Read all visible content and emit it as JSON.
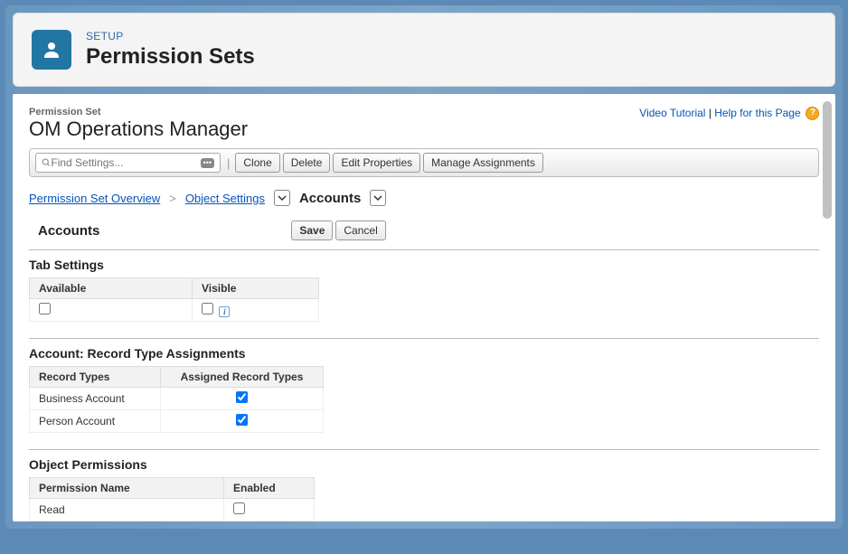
{
  "header": {
    "eyebrow": "SETUP",
    "title": "Permission Sets"
  },
  "page": {
    "subtitle": "Permission Set",
    "name": "OM Operations Manager",
    "links": {
      "video": "Video Tutorial",
      "help": "Help for this Page"
    }
  },
  "toolbar": {
    "search_placeholder": "Find Settings...",
    "buttons": {
      "clone": "Clone",
      "delete": "Delete",
      "edit": "Edit Properties",
      "assign": "Manage Assignments"
    }
  },
  "breadcrumb": {
    "overview": "Permission Set Overview",
    "object_settings": "Object Settings",
    "current": "Accounts"
  },
  "panel": {
    "title": "Accounts",
    "save": "Save",
    "cancel": "Cancel"
  },
  "sections": {
    "tab": {
      "title": "Tab Settings",
      "cols": {
        "available": "Available",
        "visible": "Visible"
      },
      "available_checked": false,
      "visible_checked": false
    },
    "record_types": {
      "title": "Account: Record Type Assignments",
      "cols": {
        "name": "Record Types",
        "assigned": "Assigned Record Types"
      },
      "rows": [
        {
          "name": "Business Account",
          "assigned": true
        },
        {
          "name": "Person Account",
          "assigned": true
        }
      ]
    },
    "object_perms": {
      "title": "Object Permissions",
      "cols": {
        "name": "Permission Name",
        "enabled": "Enabled"
      },
      "rows": [
        {
          "name": "Read",
          "enabled": false
        }
      ]
    }
  }
}
